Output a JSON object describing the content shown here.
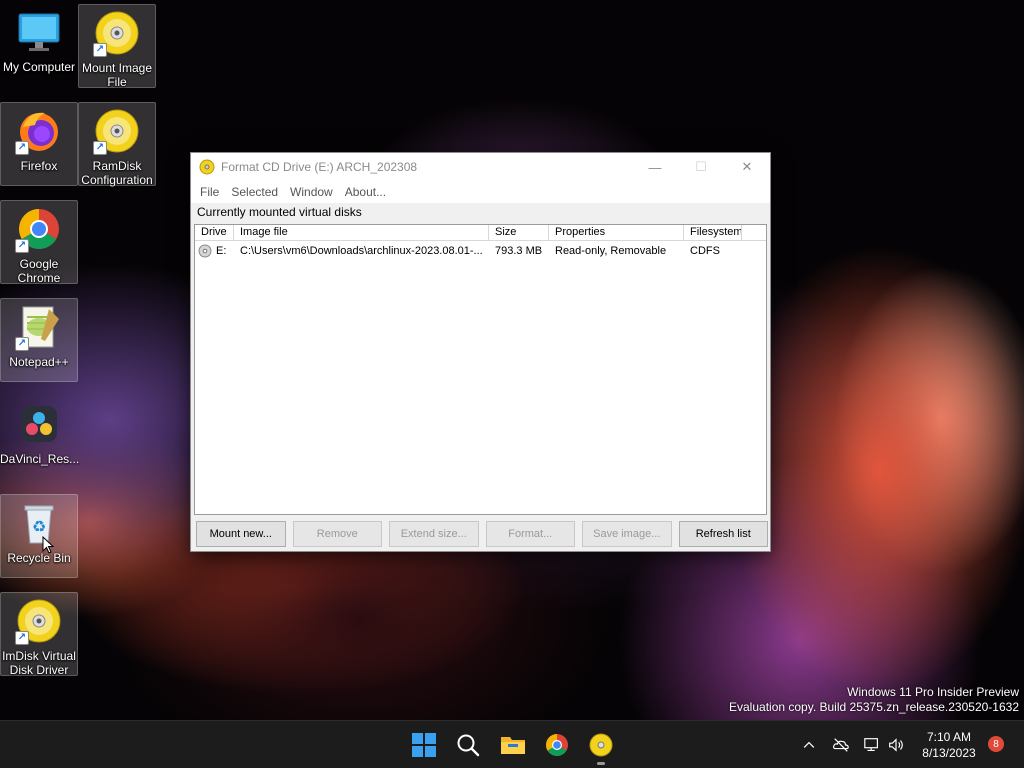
{
  "desktop": {
    "icons": [
      {
        "label": "My Computer"
      },
      {
        "label": "Mount Image File"
      },
      {
        "label": "Firefox"
      },
      {
        "label": "RamDisk Configuration"
      },
      {
        "label": "Google Chrome"
      },
      {
        "label": "Notepad++"
      },
      {
        "label": "DaVinci_Res..."
      },
      {
        "label": "Recycle Bin"
      },
      {
        "label": "ImDisk Virtual Disk Driver"
      }
    ]
  },
  "window": {
    "title": "Format CD Drive (E:) ARCH_202308",
    "menu": [
      "File",
      "Selected",
      "Window",
      "About..."
    ],
    "caption": "Currently mounted virtual disks",
    "columns": [
      "Drive",
      "Image file",
      "Size",
      "Properties",
      "Filesystem"
    ],
    "rows": [
      {
        "drive": "E:",
        "image": "C:\\Users\\vm6\\Downloads\\archlinux-2023.08.01-...",
        "size": "793.3 MB",
        "properties": "Read-only, Removable",
        "filesystem": "CDFS"
      }
    ],
    "buttons": {
      "mount": "Mount new...",
      "remove": "Remove",
      "extend": "Extend size...",
      "format": "Format...",
      "save": "Save image...",
      "refresh": "Refresh list"
    }
  },
  "watermark": {
    "line1": "Windows 11 Pro Insider Preview",
    "line2": "Evaluation copy. Build 25375.zn_release.230520-1632"
  },
  "taskbar": {
    "time": "7:10 AM",
    "date": "8/13/2023",
    "notification_count": "8"
  },
  "colors": {
    "accent": "#0078d4",
    "taskbar": "#1c1c1c",
    "badge": "#e04a3b"
  }
}
